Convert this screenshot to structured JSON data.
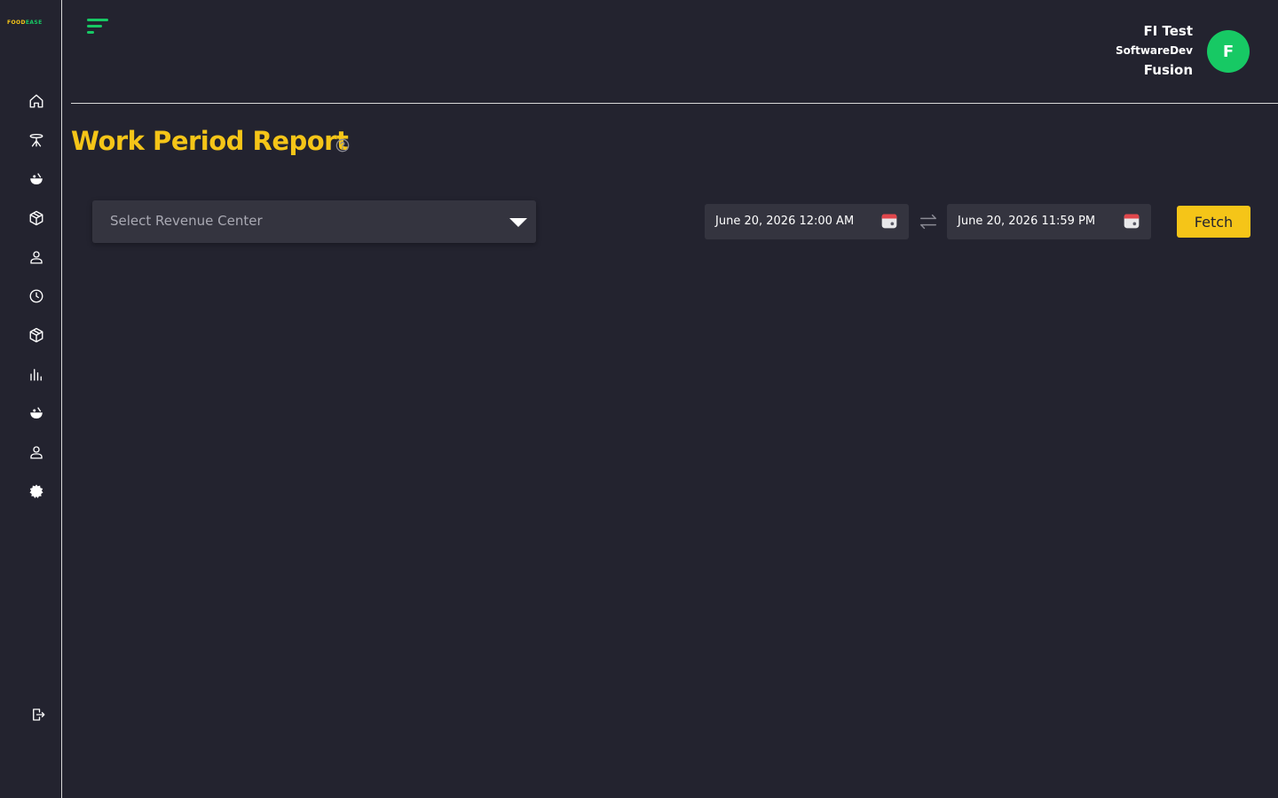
{
  "app": {
    "logo_text_part1": "FOOD",
    "logo_text_part2": "EASE",
    "colors": {
      "background": "#23232f",
      "accent_yellow": "#f5c518",
      "accent_green": "#17c964",
      "field_bg": "#34343f"
    }
  },
  "sidebar": {
    "items": [
      {
        "icon": "home-icon"
      },
      {
        "icon": "dining-table-icon"
      },
      {
        "icon": "food-bowl-icon"
      },
      {
        "icon": "package-icon"
      },
      {
        "icon": "user-icon"
      },
      {
        "icon": "clock-icon"
      },
      {
        "icon": "package-icon"
      },
      {
        "icon": "bar-chart-icon"
      },
      {
        "icon": "food-bowl-icon"
      },
      {
        "icon": "user-icon"
      },
      {
        "icon": "gear-icon"
      }
    ],
    "logout_icon": "logout-icon"
  },
  "header": {
    "menu_icon": "menu-toggle-icon",
    "user": {
      "name": "FI Test",
      "company": "SoftwareDev",
      "branch": "Fusion",
      "avatar_initial": "F"
    }
  },
  "page": {
    "title": "Work Period Report",
    "help_icon": "help-circle-icon"
  },
  "filters": {
    "revenue_center_placeholder": "Select Revenue Center",
    "start_date": "June 20, 2026 12:00 AM",
    "end_date": "June 20, 2026 11:59 PM",
    "fetch_label": "Fetch"
  }
}
